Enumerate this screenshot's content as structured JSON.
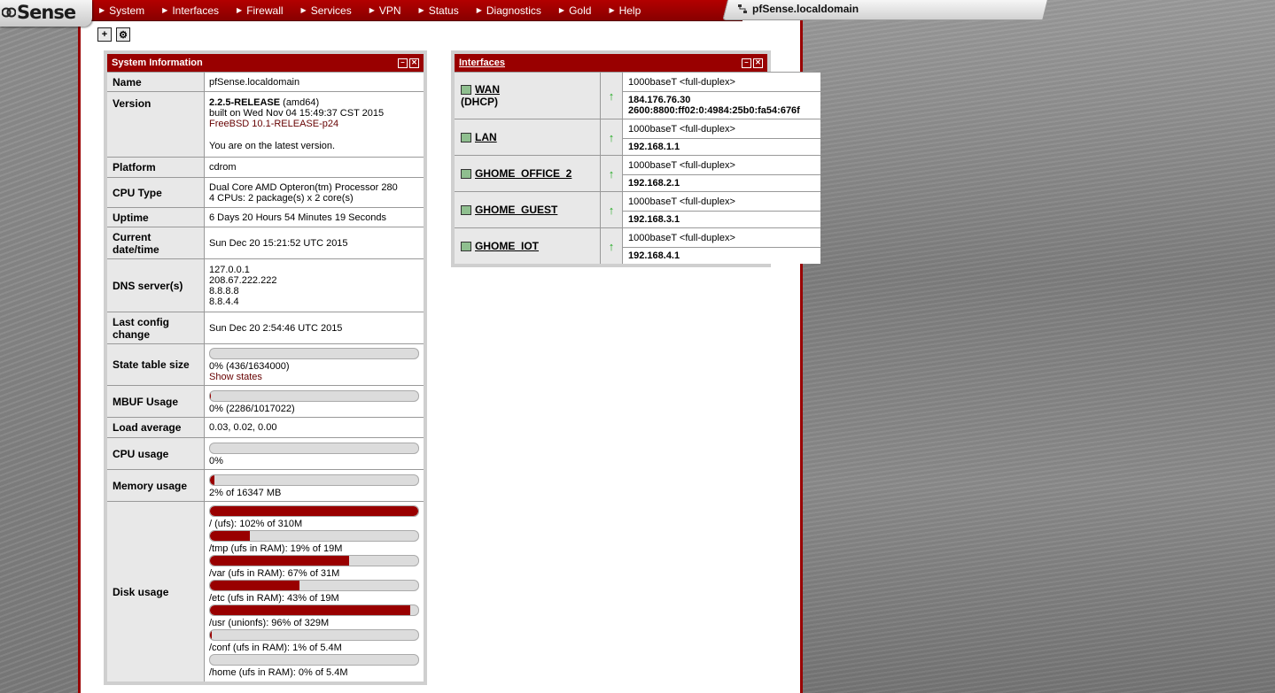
{
  "app": {
    "logo": "Sense",
    "hostname": "pfSense.localdomain",
    "colors": {
      "brand": "#990000",
      "panel": "#cfcfcf",
      "label_bg": "#e8e8e8",
      "status_up": "#22aa22"
    }
  },
  "nav": [
    "System",
    "Interfaces",
    "Firewall",
    "Services",
    "VPN",
    "Status",
    "Diagnostics",
    "Gold",
    "Help"
  ],
  "toolbar": {
    "add_widget_icon": "add-widget-icon",
    "settings_icon": "settings-icon"
  },
  "system_info": {
    "title": "System Information",
    "name_label": "Name",
    "name": "pfSense.localdomain",
    "version_label": "Version",
    "version_release": "2.2.5-RELEASE",
    "version_arch": "(amd64)",
    "version_built": "built on Wed Nov 04 15:49:37 CST 2015",
    "version_os": "FreeBSD 10.1-RELEASE-p24",
    "version_status": "You are on the latest version.",
    "platform_label": "Platform",
    "platform": "cdrom",
    "cpu_type_label": "CPU Type",
    "cpu_type_line1": "Dual Core AMD Opteron(tm) Processor 280",
    "cpu_type_line2": "4 CPUs: 2 package(s) x 2 core(s)",
    "uptime_label": "Uptime",
    "uptime": "6 Days 20 Hours 54 Minutes 19 Seconds",
    "datetime_label": "Current date/time",
    "datetime": "Sun Dec 20 15:21:52 UTC 2015",
    "dns_label": "DNS server(s)",
    "dns": [
      "127.0.0.1",
      "208.67.222.222",
      "8.8.8.8",
      "8.8.4.4"
    ],
    "lastconfig_label": "Last config change",
    "lastconfig": "Sun Dec 20 2:54:46 UTC 2015",
    "state_label": "State table size",
    "state_value": "0% (436/1634000)",
    "state_fraction": 0.0003,
    "show_states": "Show states",
    "mbuf_label": "MBUF Usage",
    "mbuf_value": "0% (2286/1017022)",
    "mbuf_fraction": 0.002,
    "load_label": "Load average",
    "load": "0.03, 0.02, 0.00",
    "cpu_label": "CPU usage",
    "cpu_value": "0%",
    "cpu_fraction": 0,
    "memory_label": "Memory usage",
    "memory_value": "2% of 16347 MB",
    "memory_fraction": 0.02,
    "disk_label": "Disk usage",
    "disks": [
      {
        "label": "/ (ufs): 102% of 310M",
        "fraction": 1.0
      },
      {
        "label": "/tmp (ufs in RAM): 19% of 19M",
        "fraction": 0.19
      },
      {
        "label": "/var (ufs in RAM): 67% of 31M",
        "fraction": 0.67
      },
      {
        "label": "/etc (ufs in RAM): 43% of 19M",
        "fraction": 0.43
      },
      {
        "label": "/usr (unionfs): 96% of 329M",
        "fraction": 0.96
      },
      {
        "label": "/conf (ufs in RAM): 1% of 5.4M",
        "fraction": 0.01
      },
      {
        "label": "/home (ufs in RAM): 0% of 5.4M",
        "fraction": 0.0
      }
    ]
  },
  "interfaces": {
    "title": "Interfaces",
    "items": [
      {
        "name": "WAN",
        "sub": "(DHCP)",
        "speed": "1000baseT <full-duplex>",
        "ip": "184.176.76.30",
        "ip6": "2600:8800:ff02:0:4984:25b0:fa54:676f",
        "status_icon": "up-arrow-icon"
      },
      {
        "name": "LAN",
        "sub": "",
        "speed": "1000baseT <full-duplex>",
        "ip": "192.168.1.1",
        "ip6": "",
        "status_icon": "up-arrow-icon"
      },
      {
        "name": "GHOME_OFFICE_2",
        "sub": "",
        "speed": "1000baseT <full-duplex>",
        "ip": "192.168.2.1",
        "ip6": "",
        "status_icon": "up-arrow-icon"
      },
      {
        "name": "GHOME_GUEST",
        "sub": "",
        "speed": "1000baseT <full-duplex>",
        "ip": "192.168.3.1",
        "ip6": "",
        "status_icon": "up-arrow-icon"
      },
      {
        "name": "GHOME_IOT",
        "sub": "",
        "speed": "1000baseT <full-duplex>",
        "ip": "192.168.4.1",
        "ip6": "",
        "status_icon": "up-arrow-icon"
      }
    ]
  }
}
